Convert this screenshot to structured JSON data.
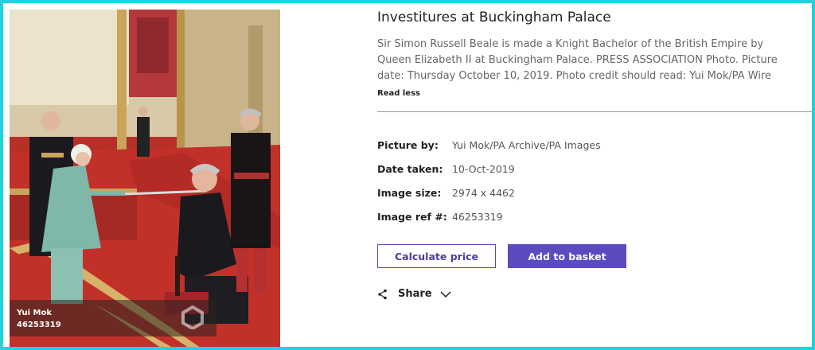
{
  "image": {
    "overlay_name": "Yui Mok",
    "overlay_ref": "46253319",
    "watermark_alt": "pa images watermark"
  },
  "details": {
    "title": "Investitures at Buckingham Palace",
    "description": "Sir Simon Russell Beale is made a Knight Bachelor of the British Empire by Queen Elizabeth II at Buckingham Palace. PRESS ASSOCIATION Photo. Picture date: Thursday October 10, 2019. Photo credit should read: Yui Mok/PA Wire",
    "read_less": "Read less"
  },
  "meta": {
    "picture_by_label": "Picture by:",
    "picture_by_value": "Yui Mok/PA Archive/PA Images",
    "date_taken_label": "Date taken:",
    "date_taken_value": "10-Oct-2019",
    "image_size_label": "Image size:",
    "image_size_value": "2974 x 4462",
    "image_ref_label": "Image ref #:",
    "image_ref_value": "46253319"
  },
  "actions": {
    "calculate_price": "Calculate price",
    "add_to_basket": "Add to basket",
    "share": "Share"
  },
  "colors": {
    "border_cyan": "#1ed3de",
    "accent_purple": "#5b4bc0"
  },
  "icons": {
    "share": "share-icon",
    "chevron": "chevron-down-icon"
  }
}
